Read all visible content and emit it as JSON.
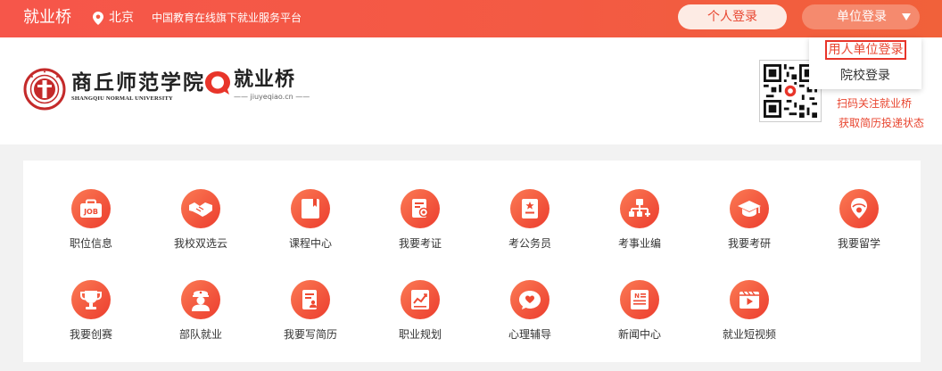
{
  "topbar": {
    "brand": "就业桥",
    "location": "北京",
    "slogan": "中国教育在线旗下就业服务平台",
    "personal_login": "个人登录",
    "unit_login": "单位登录"
  },
  "dropdown": {
    "items": [
      "用人单位登录",
      "院校登录"
    ]
  },
  "header": {
    "school_name_cn": "商丘师范学院",
    "school_name_en": "SHANGQIU NORMAL UNIVERSITY",
    "platform_name": "就业桥",
    "platform_domain": "—— jiuyeqiao.cn ——",
    "qr_hidden_text": "扫码关注就业桥",
    "qr_caption": "获取简历投递状态"
  },
  "features": [
    {
      "label": "职位信息",
      "icon": "job-icon"
    },
    {
      "label": "我校双选云",
      "icon": "handshake-icon"
    },
    {
      "label": "课程中心",
      "icon": "book-icon"
    },
    {
      "label": "我要考证",
      "icon": "certificate-icon"
    },
    {
      "label": "考公务员",
      "icon": "civil-service-icon"
    },
    {
      "label": "考事业编",
      "icon": "org-chart-icon"
    },
    {
      "label": "我要考研",
      "icon": "graduation-cap-icon"
    },
    {
      "label": "我要留学",
      "icon": "globe-pin-icon"
    },
    {
      "label": "我要创赛",
      "icon": "trophy-icon"
    },
    {
      "label": "部队就业",
      "icon": "soldier-icon"
    },
    {
      "label": "我要写简历",
      "icon": "resume-icon"
    },
    {
      "label": "职业规划",
      "icon": "trend-chart-icon"
    },
    {
      "label": "心理辅导",
      "icon": "heart-chat-icon"
    },
    {
      "label": "新闻中心",
      "icon": "news-icon"
    },
    {
      "label": "就业短视频",
      "icon": "video-icon"
    }
  ],
  "colors": {
    "brand_red": "#f35a43",
    "accent": "#e8452f"
  }
}
